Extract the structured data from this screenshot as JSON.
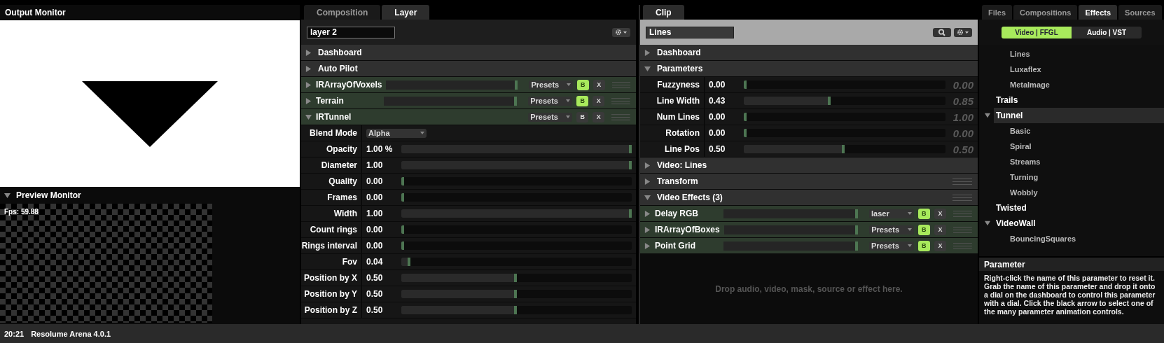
{
  "output_monitor": {
    "title": "Output Monitor"
  },
  "preview_monitor": {
    "title": "Preview Monitor",
    "expanded": true,
    "fps": "Fps: 59.88"
  },
  "layer_panel": {
    "tabs": [
      {
        "label": "Composition",
        "selected": false
      },
      {
        "label": "Layer",
        "selected": true
      }
    ],
    "name": "layer 2",
    "sections": [
      {
        "label": "Dashboard",
        "expanded": false
      },
      {
        "label": "Auto Pilot",
        "expanded": false
      }
    ],
    "effects": [
      {
        "name": "IRArrayOfVoxels",
        "expanded": false,
        "level": 1,
        "preset": "Presets",
        "b_label": "B",
        "b_on": true,
        "x_label": "X"
      },
      {
        "name": "Terrain",
        "expanded": false,
        "level": 1,
        "preset": "Presets",
        "b_label": "B",
        "b_on": true,
        "x_label": "X"
      },
      {
        "name": "IRTunnel",
        "expanded": true,
        "preset": "Presets",
        "b_label": "B",
        "b_on": false,
        "x_label": "X",
        "parameters": [
          {
            "kind": "dropdown",
            "label": "Blend Mode",
            "value": "Alpha"
          },
          {
            "kind": "slider",
            "label": "Opacity",
            "value": "1.00 %",
            "level": 1
          },
          {
            "kind": "slider",
            "label": "Diameter",
            "value": "1.00",
            "level": 1
          },
          {
            "kind": "slider",
            "label": "Quality",
            "value": "0.00",
            "level": 0
          },
          {
            "kind": "slider",
            "label": "Frames",
            "value": "0.00",
            "level": 0
          },
          {
            "kind": "slider",
            "label": "Width",
            "value": "1.00",
            "level": 1
          },
          {
            "kind": "slider",
            "label": "Count rings",
            "value": "0.00",
            "level": 0
          },
          {
            "kind": "slider",
            "label": "Rings interval",
            "value": "0.00",
            "level": 0
          },
          {
            "kind": "slider",
            "label": "Fov",
            "value": "0.04",
            "level": 0.04
          },
          {
            "kind": "slider",
            "label": "Position by X",
            "value": "0.50",
            "level": 0.5
          },
          {
            "kind": "slider",
            "label": "Position by Y",
            "value": "0.50",
            "level": 0.5
          },
          {
            "kind": "slider",
            "label": "Position by Z",
            "value": "0.50",
            "level": 0.5
          }
        ]
      }
    ]
  },
  "clip_panel": {
    "tabs": [
      {
        "label": "Clip",
        "selected": true
      }
    ],
    "name": "Lines",
    "sections": [
      {
        "label": "Dashboard",
        "expanded": false,
        "draggable": false
      },
      {
        "label": "Parameters",
        "expanded": true,
        "draggable": false,
        "parameters": [
          {
            "label": "Fuzzyness",
            "value": "0.00",
            "level": 0,
            "dial_value": "0.00"
          },
          {
            "label": "Line Width",
            "value": "0.43",
            "level": 0.43,
            "dial_value": "0.85"
          },
          {
            "label": "Num Lines",
            "value": "0.00",
            "level": 0,
            "dial_value": "1.00"
          },
          {
            "label": "Rotation",
            "value": "0.00",
            "level": 0,
            "dial_value": "0.00"
          },
          {
            "label": "Line Pos",
            "value": "0.50",
            "level": 0.5,
            "dial_value": "0.50"
          }
        ]
      },
      {
        "label": "Video: Lines",
        "expanded": false,
        "draggable": false
      },
      {
        "label": "Transform",
        "expanded": false,
        "draggable": true
      },
      {
        "label": "Video Effects (3)",
        "expanded": true,
        "draggable": true,
        "effects": [
          {
            "name": "Delay RGB",
            "expanded": false,
            "level": 1,
            "preset": "laser",
            "b_label": "B",
            "b_on": true,
            "x_label": "X"
          },
          {
            "name": "IRArrayOfBoxes",
            "expanded": false,
            "level": 1,
            "preset": "Presets",
            "b_label": "B",
            "b_on": true,
            "x_label": "X"
          },
          {
            "name": "Point Grid",
            "expanded": false,
            "level": 1,
            "preset": "Presets",
            "b_label": "B",
            "b_on": true,
            "x_label": "X"
          }
        ]
      }
    ],
    "drop_hint": "Drop audio, video, mask, source or effect here."
  },
  "browser": {
    "tabs": [
      {
        "label": "Files",
        "selected": false
      },
      {
        "label": "Compositions",
        "selected": false
      },
      {
        "label": "Effects",
        "selected": true
      },
      {
        "label": "Sources",
        "selected": false
      }
    ],
    "toggle": [
      {
        "label": "Video | FFGL",
        "selected": true
      },
      {
        "label": "Audio | VST",
        "selected": false
      }
    ],
    "tree": [
      {
        "children": [
          {
            "label": "Lines",
            "selected": false
          },
          {
            "label": "Luxaflex",
            "selected": false
          },
          {
            "label": "MetaImage",
            "selected": false
          }
        ]
      },
      {
        "label": "Trails",
        "selected": false
      },
      {
        "label": "Tunnel",
        "selected": true,
        "expanded": true,
        "children": [
          {
            "label": "Basic",
            "selected": false
          },
          {
            "label": "Spiral",
            "selected": false
          },
          {
            "label": "Streams",
            "selected": false
          },
          {
            "label": "Turning",
            "selected": false
          },
          {
            "label": "Wobbly",
            "selected": false
          }
        ]
      },
      {
        "label": "Twisted",
        "selected": false
      },
      {
        "label": "VideoWall",
        "selected": false,
        "expanded": true,
        "children": [
          {
            "label": "BouncingSquares",
            "selected": false
          }
        ]
      }
    ],
    "help": {
      "title": "Parameter",
      "text": "Right-click the name of this parameter to reset it. Grab the name of this parameter and drop it onto a dial on the dashboard to control this parameter with a dial. Click the black arrow to select one of the many parameter animation controls."
    }
  },
  "status_bar": {
    "time": "20:21",
    "app": "Resolume Arena 4.0.1"
  }
}
